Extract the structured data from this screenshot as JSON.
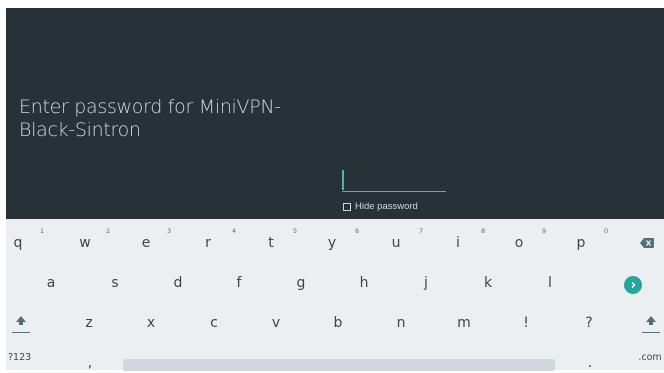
{
  "prompt": {
    "line1": "Enter password for MiniVPN-",
    "line2": "Black-Sintron"
  },
  "password": {
    "value": ""
  },
  "hide_password": {
    "label": "Hide password",
    "checked": false
  },
  "keyboard": {
    "row1": [
      {
        "label": "q",
        "hint": "1"
      },
      {
        "label": "w",
        "hint": "2"
      },
      {
        "label": "e",
        "hint": "3"
      },
      {
        "label": "r",
        "hint": "4"
      },
      {
        "label": "t",
        "hint": "5"
      },
      {
        "label": "y",
        "hint": "6"
      },
      {
        "label": "u",
        "hint": "7"
      },
      {
        "label": "i",
        "hint": "8"
      },
      {
        "label": "o",
        "hint": "9"
      },
      {
        "label": "p",
        "hint": "0"
      }
    ],
    "row2": [
      "a",
      "s",
      "d",
      "f",
      "g",
      "h",
      "j",
      "k",
      "l"
    ],
    "row3": [
      "z",
      "x",
      "c",
      "v",
      "b",
      "n",
      "m",
      "!",
      "?"
    ],
    "symbols_label": "?123",
    "comma_label": ",",
    "period_label": ".",
    "dotcom_label": ".com",
    "icons": {
      "backspace": "backspace-icon",
      "go": "go-arrow-icon",
      "shift": "shift-icon"
    },
    "accent_color": "#26a69a"
  }
}
